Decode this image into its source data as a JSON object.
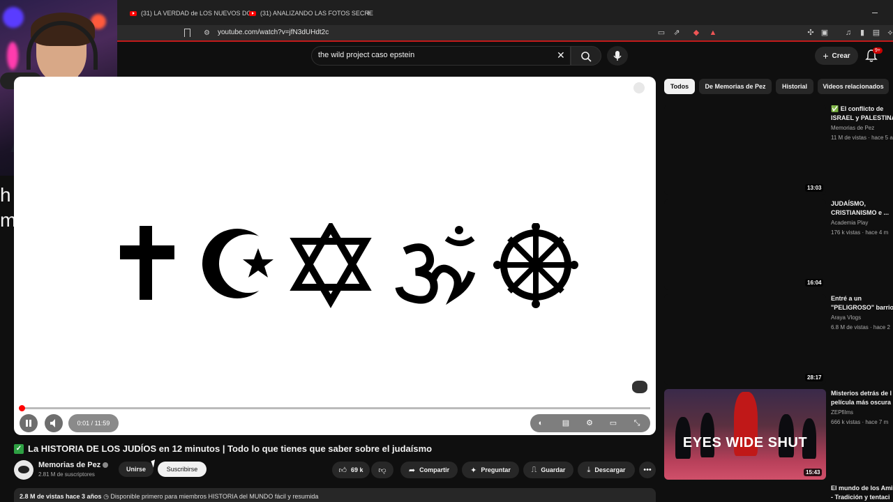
{
  "browser": {
    "tabs": [
      {
        "label": "(31) LA VERDAD de LOS NUEVOS DO"
      },
      {
        "label": "(31) ANALIZANDO LAS FOTOS SECRE"
      }
    ],
    "new_tab": "+",
    "url": "youtube.com/watch?v=jfN3dUHdt2c"
  },
  "header": {
    "search_query": "the wild project caso epstein",
    "create_label": "Crear",
    "notification_badge": "9+"
  },
  "overlay_text": {
    "line1": "h",
    "line2": "m"
  },
  "player": {
    "time": "0:01 / 11:59",
    "progress_fraction": 0.001,
    "symbols": [
      "cross-icon",
      "crescent-star-icon",
      "star-of-david-icon",
      "om-icon",
      "dharma-wheel-icon"
    ]
  },
  "video": {
    "title": "La HISTORIA DE LOS JUDÍOS en 12 minutos | Todo lo que tienes que saber sobre el judaísmo",
    "channel": "Memorias de Pez",
    "subscribers": "2.81 M de suscriptores",
    "join_label": "Unirse",
    "subscribe_label": "Suscribirse",
    "likes": "69 k",
    "share_label": "Compartir",
    "ask_label": "Preguntar",
    "save_label": "Guardar",
    "download_label": "Descargar",
    "views_date": "2.8 M de vistas  hace 3 años",
    "members_note": "◷ Disponible primero para miembros",
    "playlist": "HISTORIA del MUNDO fácil y resumida"
  },
  "chips": [
    "Todos",
    "De Memorias de Pez",
    "Historial",
    "Videos relacionados"
  ],
  "recommendations": [
    {
      "title_line1": "✅ El conflicto de",
      "title_line2": "ISRAEL y PALESTINA",
      "channel": "Memorias de Pez",
      "meta": "11 M de vistas · hace 5 a",
      "duration": ""
    },
    {
      "title_line1": "JUDAÍSMO,",
      "title_line2": "CRISTIANISMO e ...",
      "channel": "Academia Play",
      "meta": "176 k vistas · hace 4 m",
      "duration": "13:03"
    },
    {
      "title_line1": "Entré a un",
      "title_line2": "\"PELIGROSO\" barrio",
      "channel": "Araya Vlogs",
      "meta": "6.8 M de vistas · hace 2",
      "duration": "16:04"
    },
    {
      "title_line1": "Misterios detrás de l",
      "title_line2": "película más oscura",
      "channel": "ZEPfilms",
      "meta": "666 k vistas · hace 7 m",
      "duration": "28:17"
    },
    {
      "title_line1": "El mundo de los Ami",
      "title_line2": "- Tradición y tentaci",
      "channel": "",
      "meta": "",
      "duration": "15:43"
    }
  ],
  "ews_thumb_text": "EYES WIDE SHUT",
  "colors": {
    "accent": "#ff0000",
    "background": "#0f0f0f",
    "verified_check": "#2ea043"
  }
}
